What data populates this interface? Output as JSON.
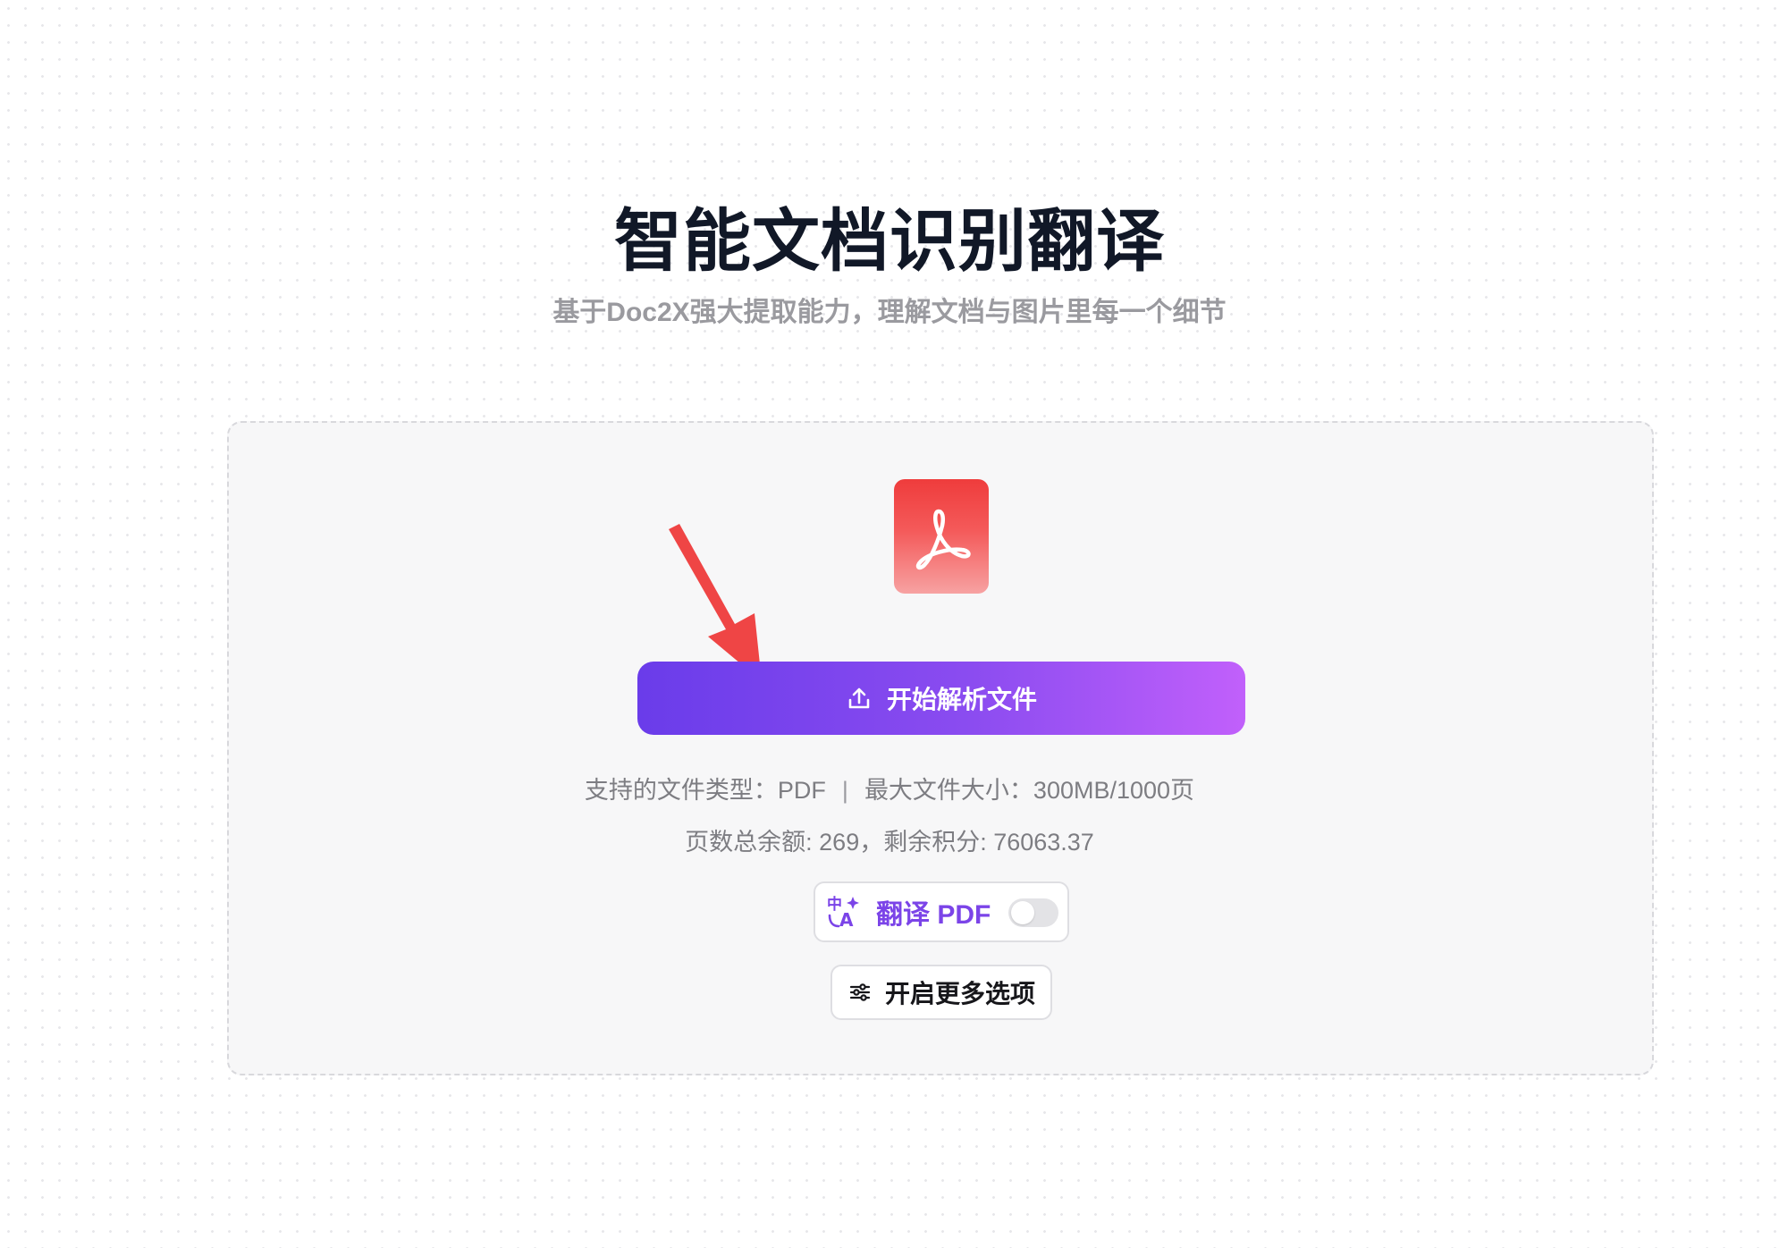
{
  "header": {
    "title": "智能文档识别翻译",
    "subtitle": "基于Doc2X强大提取能力，理解文档与图片里每一个细节"
  },
  "upload": {
    "logo_icon": "adobe-pdf-icon",
    "button_label": "开始解析文件",
    "button_icon": "upload-icon",
    "supported_types_text": "支持的文件类型：PDF",
    "separator": "|",
    "max_size_text": "最大文件大小：300MB/1000页",
    "quota_text": "页数总余额: 269，剩余积分: 76063.37"
  },
  "translate": {
    "icon": "translate-icon",
    "label": "翻译 PDF",
    "enabled": false
  },
  "options": {
    "icon": "sliders-icon",
    "label": "开启更多选项"
  },
  "colors": {
    "title": "#111827",
    "subtitle": "#9a9a9f",
    "button_gradient_start": "#6a3cea",
    "button_gradient_end": "#c160fb",
    "translate_accent": "#7b44e8",
    "pdf_logo_red": "#ef3c3c",
    "annotation_arrow": "#ef4545"
  }
}
